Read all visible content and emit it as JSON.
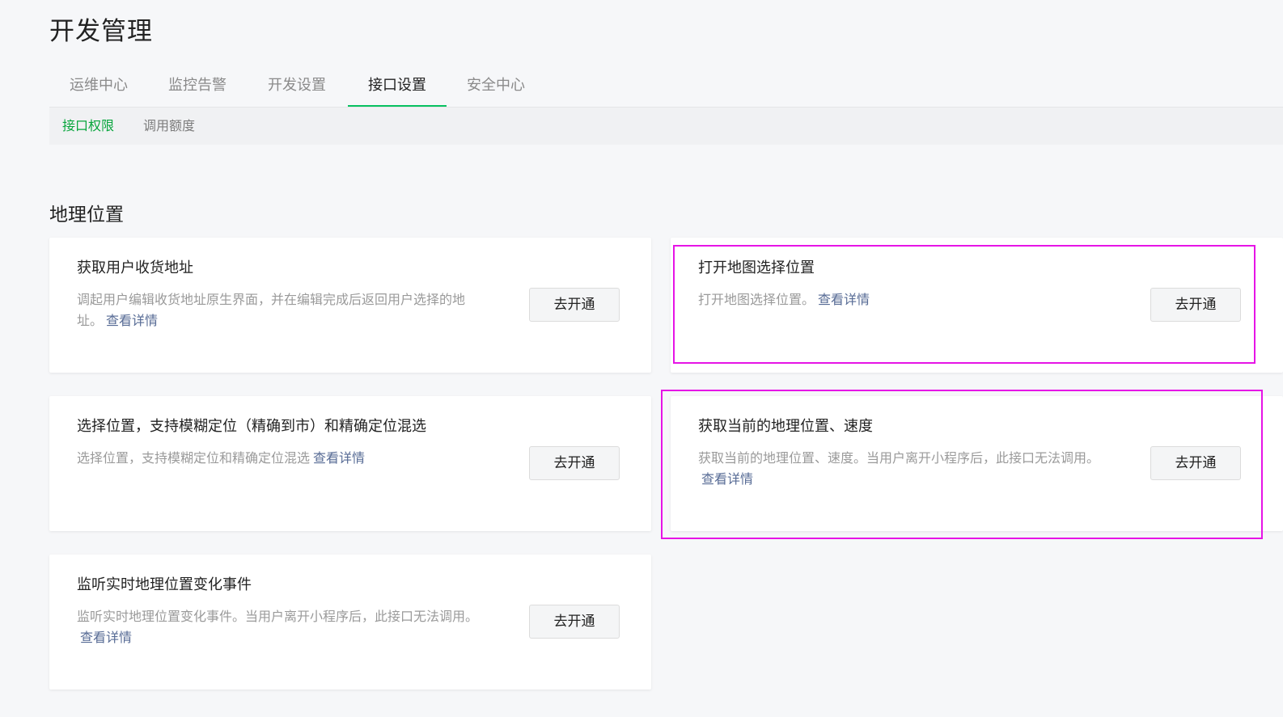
{
  "page_title": "开发管理",
  "tabs": [
    {
      "label": "运维中心"
    },
    {
      "label": "监控告警"
    },
    {
      "label": "开发设置"
    },
    {
      "label": "接口设置"
    },
    {
      "label": "安全中心"
    }
  ],
  "subtabs": [
    {
      "label": "接口权限"
    },
    {
      "label": "调用额度"
    }
  ],
  "section_title": "地理位置",
  "cards": [
    {
      "title": "获取用户收货地址",
      "desc": "调起用户编辑收货地址原生界面，并在编辑完成后返回用户选择的地址。",
      "link": "查看详情",
      "button": "去开通"
    },
    {
      "title": "打开地图选择位置",
      "desc": "打开地图选择位置。",
      "link": "查看详情",
      "button": "去开通"
    },
    {
      "title": "选择位置，支持模糊定位（精确到市）和精确定位混选",
      "desc": "选择位置，支持模糊定位和精确定位混选",
      "link": "查看详情",
      "button": "去开通"
    },
    {
      "title": "获取当前的地理位置、速度",
      "desc": "获取当前的地理位置、速度。当用户离开小程序后，此接口无法调用。",
      "link": "查看详情",
      "button": "去开通"
    },
    {
      "title": "监听实时地理位置变化事件",
      "desc": "监听实时地理位置变化事件。当用户离开小程序后，此接口无法调用。",
      "link": "查看详情",
      "button": "去开通"
    }
  ],
  "colors": {
    "accent_green": "#07c160",
    "link": "#576b95",
    "highlight": "#e614e6"
  }
}
